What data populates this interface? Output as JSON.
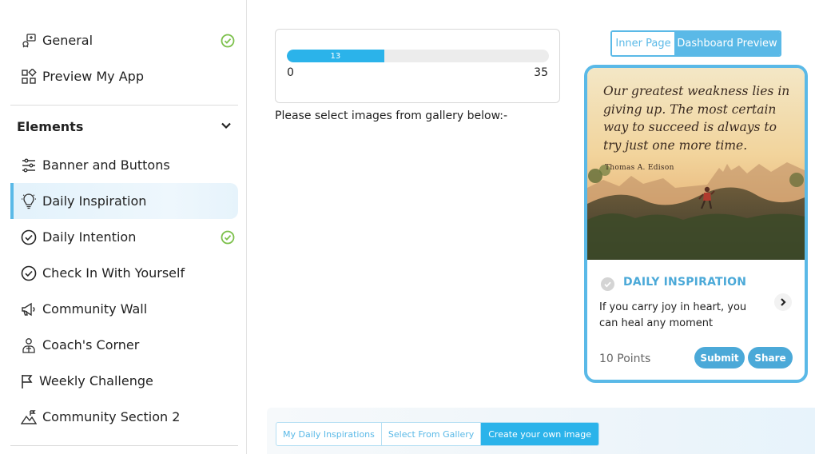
{
  "sidebar": {
    "top_items": [
      {
        "label": "General",
        "icon": "settings-chat-icon",
        "completed": true
      },
      {
        "label": "Preview My App",
        "icon": "apps-grid-icon",
        "completed": false
      }
    ],
    "section_title": "Elements",
    "items": [
      {
        "label": "Banner and Buttons",
        "icon": "sliders-icon",
        "completed": false
      },
      {
        "label": "Daily Inspiration",
        "icon": "lightbulb-icon",
        "completed": false,
        "active": true
      },
      {
        "label": "Daily Intention",
        "icon": "check-circle-icon",
        "completed": true
      },
      {
        "label": "Check In With Yourself",
        "icon": "check-circle-icon",
        "completed": false
      },
      {
        "label": "Community Wall",
        "icon": "megaphone-icon",
        "completed": false
      },
      {
        "label": "Coach's Corner",
        "icon": "coach-icon",
        "completed": false
      },
      {
        "label": "Weekly Challenge",
        "icon": "flag-icon",
        "completed": false
      },
      {
        "label": "Community Section 2",
        "icon": "mountain-icon",
        "completed": false
      }
    ]
  },
  "progress": {
    "current": "13",
    "min": "0",
    "max": "35",
    "fraction": 0.371
  },
  "gallery_prompt": "Please select images from gallery below:-",
  "preview_toggle": {
    "inner_page": "Inner Page",
    "dashboard_preview": "Dashboard Preview"
  },
  "preview_card": {
    "quote": "Our greatest weakness lies in giving up. The most certain way to succeed is always to try just one more time.",
    "author": "Thomas A. Edison",
    "title": "DAILY INSPIRATION",
    "body": "If you carry joy in heart, you can heal any moment",
    "points": "10 Points",
    "submit_label": "Submit",
    "share_label": "Share"
  },
  "bottom_tabs": [
    {
      "label": "My Daily Inspirations",
      "active": false
    },
    {
      "label": "Select From Gallery",
      "active": false
    },
    {
      "label": "Create your own image",
      "active": true
    }
  ],
  "colors": {
    "accent": "#5ab9e7",
    "progress_fill": "#2bb3ea",
    "check_green": "#7cc04b",
    "title_blue": "#4ba9d8"
  }
}
